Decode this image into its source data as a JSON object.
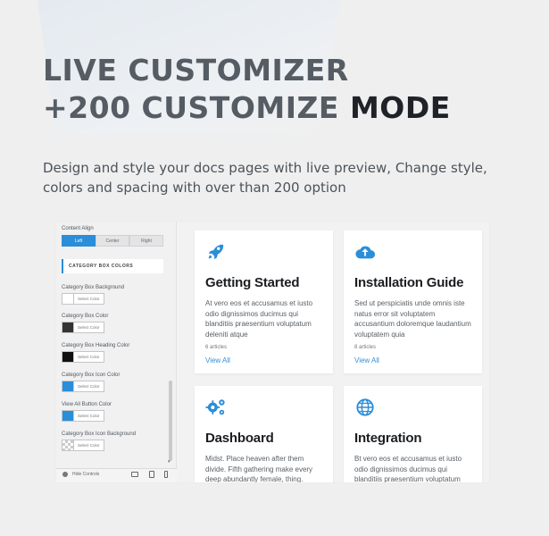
{
  "hero": {
    "line1": "LIVE CUSTOMIZER",
    "line2_a": "+200 CUSTOMIZE",
    "line2_b": "MODE",
    "subtitle": "Design and style your docs pages with live preview, Change style, colors and spacing with over than 200 option"
  },
  "colors": {
    "accent": "#2b8ed8",
    "link": "#3a8ed4"
  },
  "panel": {
    "content_align_label": "Content Align",
    "align_options": [
      "Left",
      "Center",
      "Right"
    ],
    "selected_align": "Left",
    "section_title": "CATEGORY BOX COLORS",
    "color_settings": [
      {
        "label": "Category Box Background",
        "button": "Select Color",
        "color": "#ffffff"
      },
      {
        "label": "Category Box Color",
        "button": "Select Color",
        "color": "#333333"
      },
      {
        "label": "Category Box Heading Color",
        "button": "Select Color",
        "color": "#111111"
      },
      {
        "label": "Category Box Icon Color",
        "button": "Select Color",
        "color": "#2b8ed8"
      },
      {
        "label": "View All Button Color",
        "button": "Select Color",
        "color": "#2b8ed8"
      },
      {
        "label": "Category Box Icon Background",
        "button": "Select Color",
        "color": "transparent"
      }
    ],
    "hide_controls": "Hide Controls"
  },
  "cards": [
    {
      "icon": "rocket-icon",
      "title": "Getting Started",
      "text": "At vero eos et accusamus et iusto odio dignissimos ducimus qui blanditiis praesentium voluptatum deleniti atque",
      "count": "6 articles",
      "link": "View All"
    },
    {
      "icon": "cloud-upload-icon",
      "title": "Installation Guide",
      "text": "Sed ut perspiciatis unde omnis iste natus error sit voluptatem accusantium doloremque laudantium voluptatem quia",
      "count": "8 articles",
      "link": "View All"
    },
    {
      "icon": "gears-icon",
      "title": "Dashboard",
      "text": "Midst. Place heaven after them divide. Fifth gathering make every deep abundantly female, thing."
    },
    {
      "icon": "globe-icon",
      "title": "Integration",
      "text": "Bt vero eos et accusamus et iusto odio dignissimos ducimus qui blanditiis praesentium voluptatum"
    }
  ]
}
